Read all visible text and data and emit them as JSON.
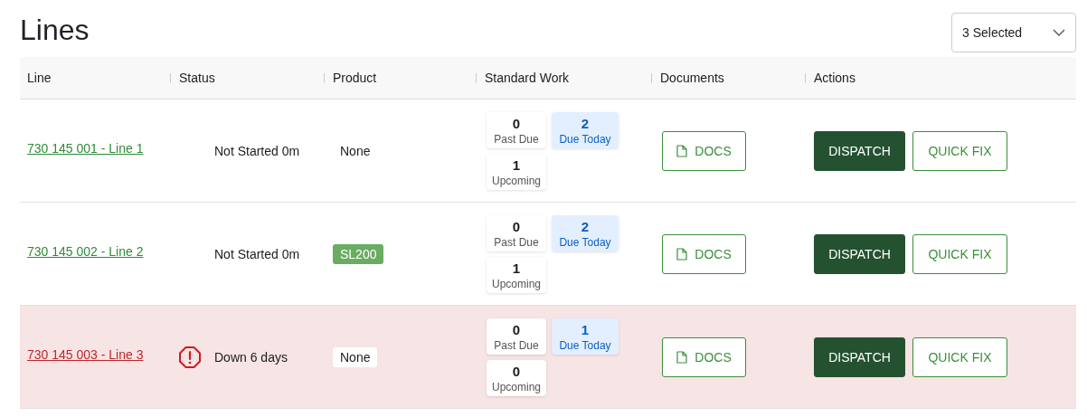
{
  "title": "Lines",
  "filter": {
    "value": "3 Selected"
  },
  "table": {
    "columns": [
      "Line",
      "Status",
      "Product",
      "Standard Work",
      "Documents",
      "Actions"
    ],
    "rows": [
      {
        "line": "730 145 001 - Line 1",
        "down": false,
        "status": "Not Started 0m",
        "product": {
          "text": "None",
          "kind": "plain"
        },
        "work": [
          {
            "kind": "past_due",
            "count": "0",
            "label": "Past Due"
          },
          {
            "kind": "due_today",
            "count": "2",
            "label": "Due Today"
          },
          {
            "kind": "upcoming",
            "count": "1",
            "label": "Upcoming"
          }
        ],
        "docs": "DOCS",
        "actions": [
          "DISPATCH",
          "QUICK FIX"
        ]
      },
      {
        "line": "730 145 002 - Line 2",
        "down": false,
        "status": "Not Started 0m",
        "product": {
          "text": "SL200",
          "kind": "tag"
        },
        "work": [
          {
            "kind": "past_due",
            "count": "0",
            "label": "Past Due"
          },
          {
            "kind": "due_today",
            "count": "2",
            "label": "Due Today"
          },
          {
            "kind": "upcoming",
            "count": "1",
            "label": "Upcoming"
          }
        ],
        "docs": "DOCS",
        "actions": [
          "DISPATCH",
          "QUICK FIX"
        ]
      },
      {
        "line": "730 145 003 - Line 3",
        "down": true,
        "status": "Down 6 days",
        "product": {
          "text": "None",
          "kind": "plain"
        },
        "work": [
          {
            "kind": "past_due",
            "count": "0",
            "label": "Past Due"
          },
          {
            "kind": "due_today",
            "count": "1",
            "label": "Due Today"
          },
          {
            "kind": "upcoming",
            "count": "0",
            "label": "Upcoming"
          }
        ],
        "docs": "DOCS",
        "actions": [
          "DISPATCH",
          "QUICK FIX"
        ]
      }
    ]
  }
}
